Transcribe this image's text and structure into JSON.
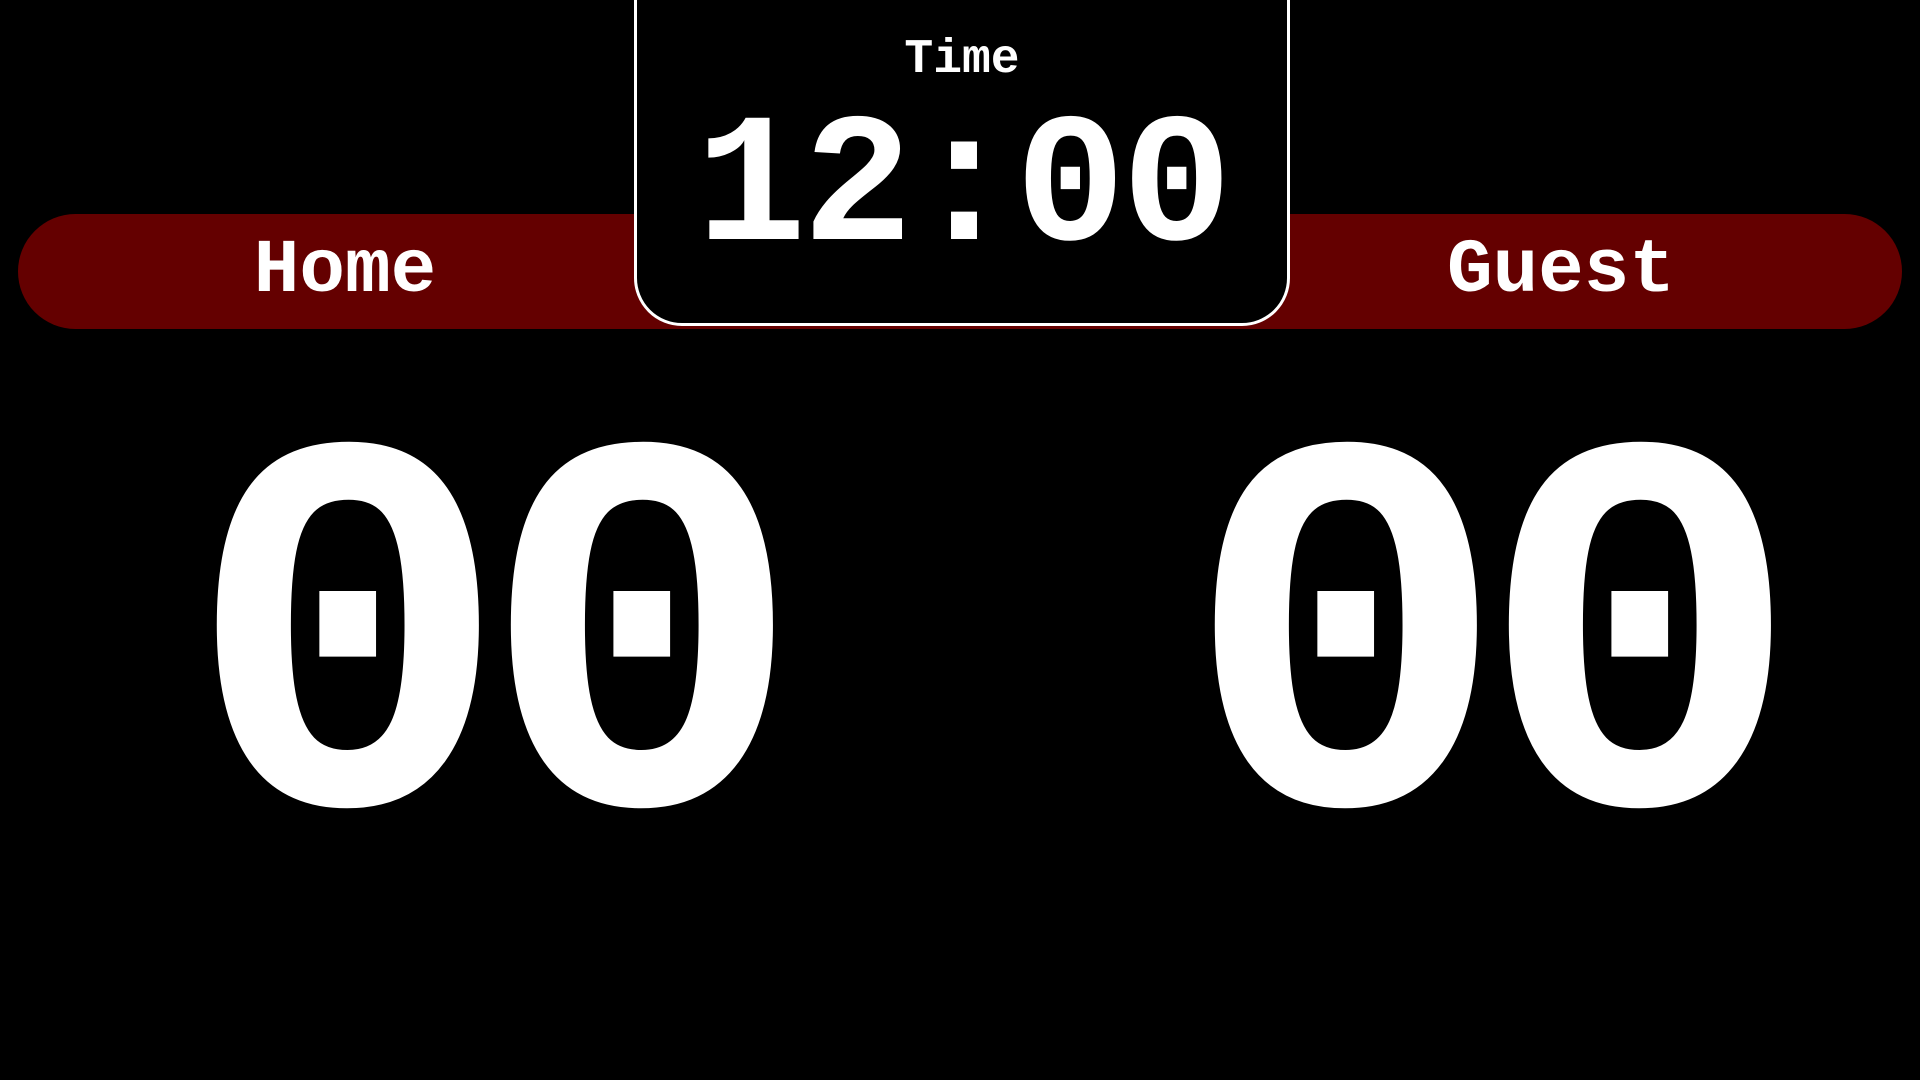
{
  "home": {
    "name": "Home",
    "score": "00"
  },
  "guest": {
    "name": "Guest",
    "score": "00"
  },
  "timer": {
    "label": "Time",
    "value": "12:00"
  },
  "colors": {
    "background": "#000000",
    "team_bar": "#640000",
    "text": "#ffffff",
    "timer_border": "#ffffff"
  }
}
